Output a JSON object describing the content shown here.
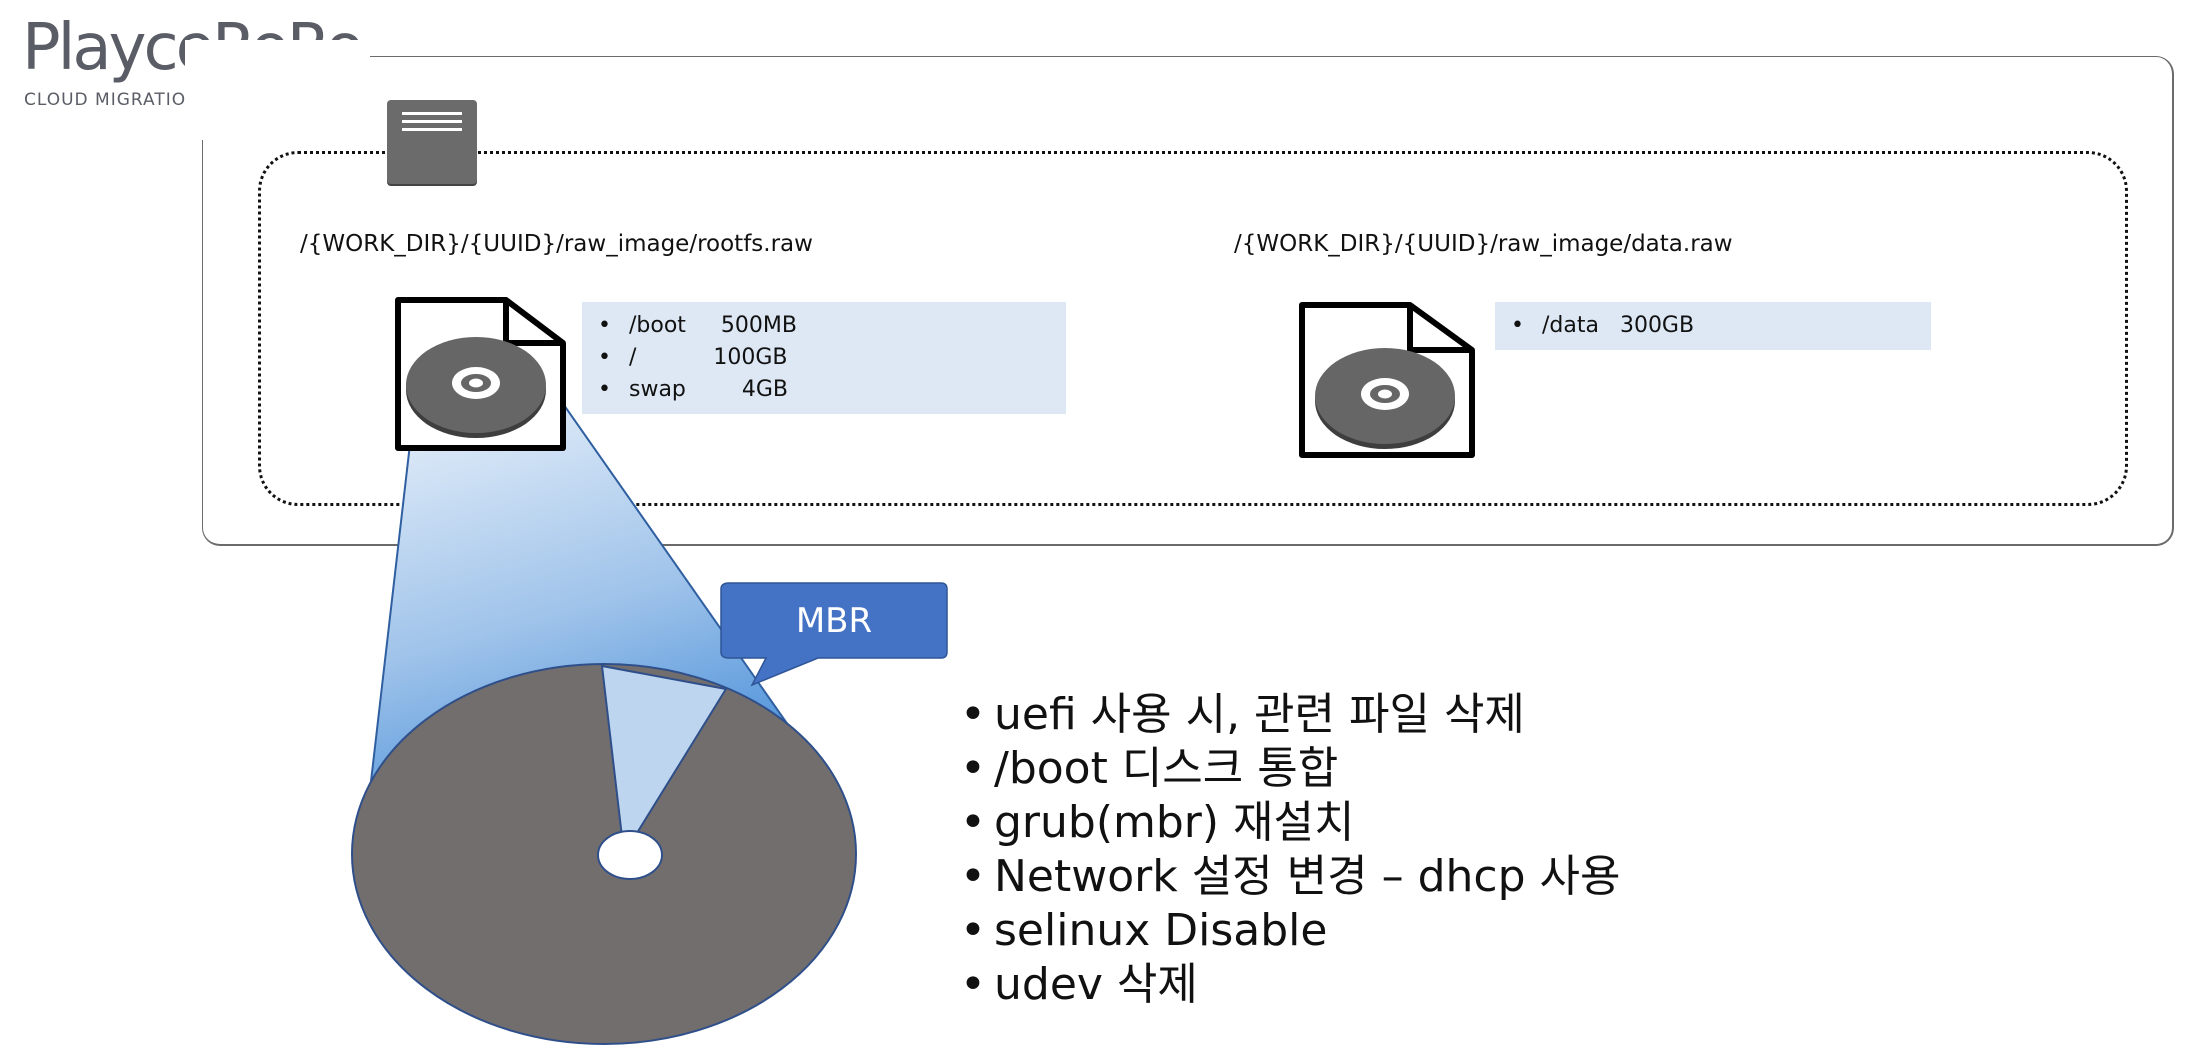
{
  "logo": {
    "word_part1": "Playce",
    "word_part2": "RoRo",
    "subtitle": "CLOUD MIGRATION",
    "colors": {
      "gray": "#5a5d66",
      "blue": "#4a90d9"
    }
  },
  "image1": {
    "path": "/{WORK_DIR}/{UUID}/raw_image/rootfs.raw",
    "partitions": [
      "/boot     500MB",
      "/           100GB",
      "swap        4GB"
    ]
  },
  "image2": {
    "path": "/{WORK_DIR}/{UUID}/raw_image/data.raw",
    "partitions": [
      "/data   300GB"
    ]
  },
  "mbr_callout": "MBR",
  "steps": [
    "uefi 사용 시, 관련 파일 삭제",
    "/boot 디스크 통합",
    "grub(mbr) 재설치",
    "Network 설정 변경 – dhcp 사용",
    "selinux Disable",
    "udev 삭제"
  ],
  "colors": {
    "disk_gray": "#736e6e",
    "slice_light": "#bdd5ee",
    "callout_blue": "#4472c4",
    "info_bg": "#dde8f4"
  }
}
